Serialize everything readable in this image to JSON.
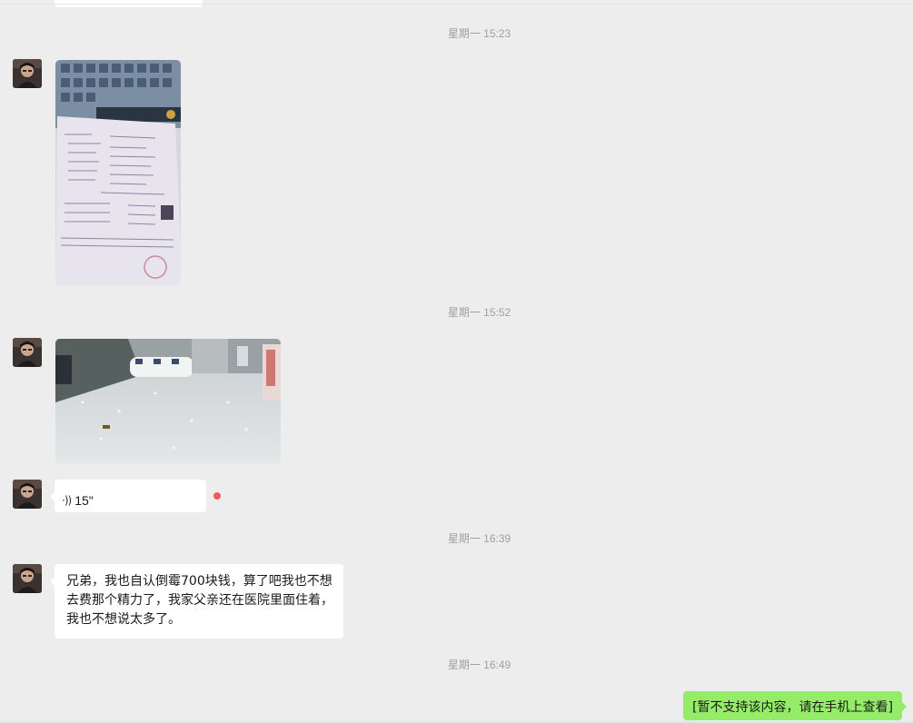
{
  "chat": {
    "timestamps": [
      "星期一 15:23",
      "星期一 15:52",
      "星期一 16:39",
      "星期一 16:49"
    ],
    "received": {
      "photo_1_icon": "document-photo",
      "photo_2_icon": "hall-photo",
      "voice": {
        "icon": "voice-wave-icon",
        "glyph": "·))",
        "duration": "15\""
      },
      "text_message": "兄弟，我也自认倒霉700块钱，算了吧我也不想去费那个精力了，我家父亲还在医院里面住着，我也不想说太多了。"
    },
    "sent": {
      "text_message": "[暂不支持该内容，请在手机上查看]"
    }
  },
  "colors": {
    "background": "#ededed",
    "received_bubble": "#ffffff",
    "sent_bubble": "#95ec69",
    "unread_dot": "#f05a5a",
    "timestamp_text": "#a0a0a0"
  }
}
